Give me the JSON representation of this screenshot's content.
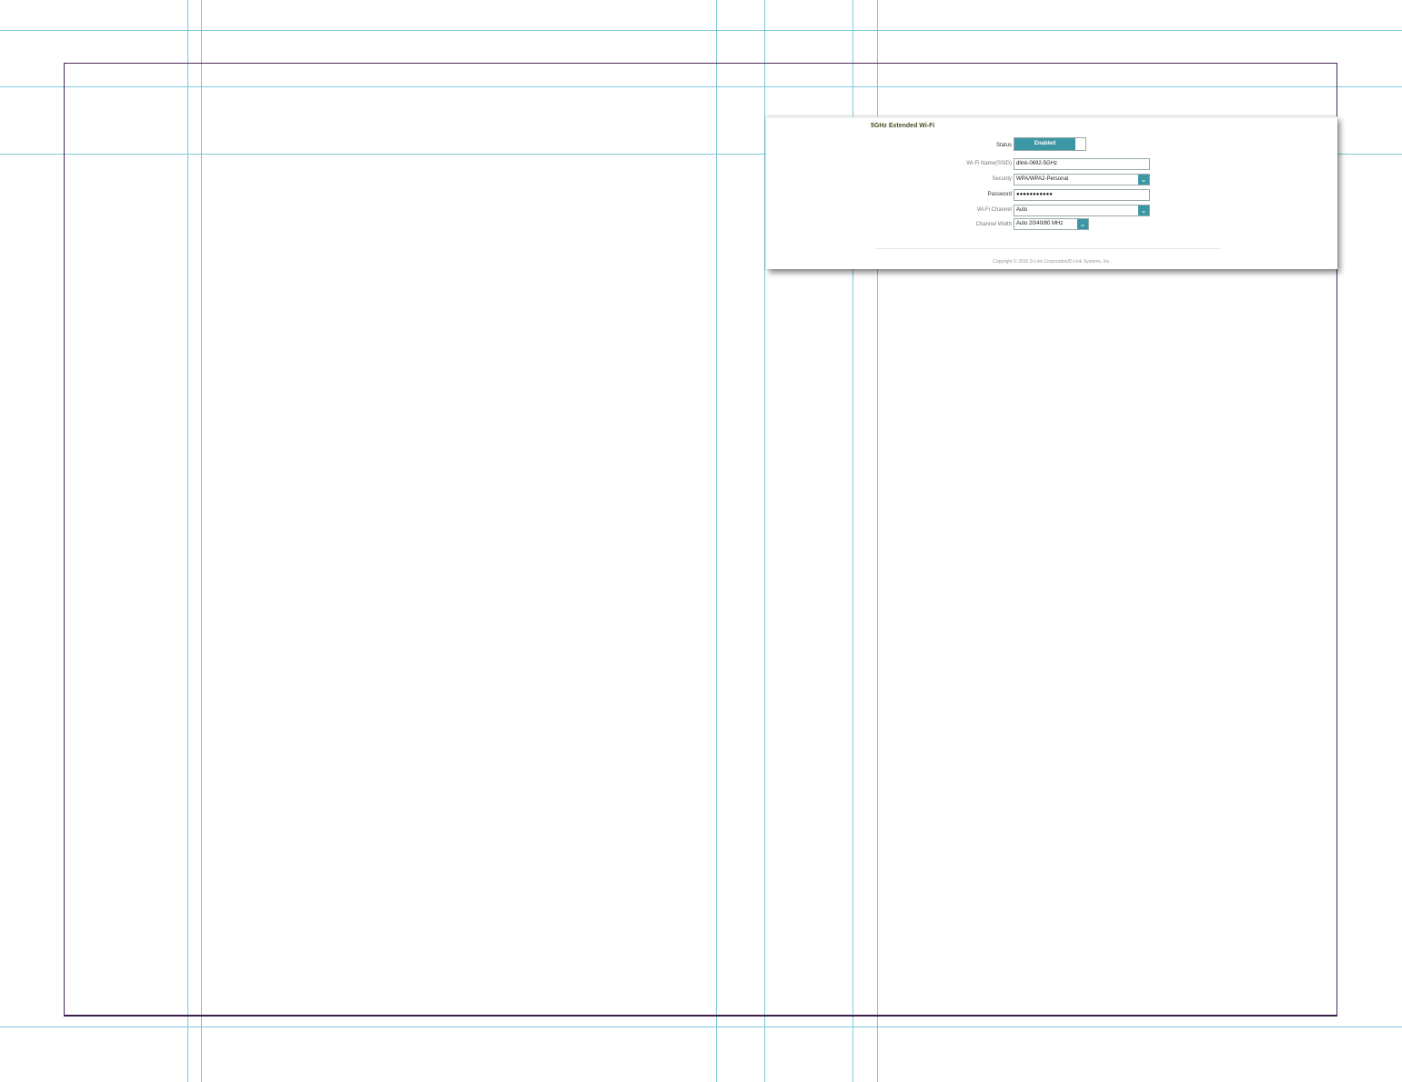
{
  "section": {
    "title": "5GHz Extended Wi-Fi"
  },
  "rows": {
    "status": {
      "label": "Status",
      "value": "Enabled"
    },
    "ssid": {
      "label": "Wi-Fi Name(SSID)",
      "value": "dlink-0692-5GHz"
    },
    "security": {
      "label": "Security",
      "value": "WPA/WPA2-Personal"
    },
    "password": {
      "label": "Password",
      "value": "●●●●●●●●●●●"
    },
    "channel": {
      "label": "Wi-Fi Channel",
      "value": "Auto"
    },
    "width": {
      "label": "Channel Width",
      "value": "Auto 20/40/80 MHz"
    }
  },
  "footer": {
    "copyright": "Copyright © 2015 D-Link Corporation/D-Link Systems, Inc."
  },
  "colors": {
    "accent": "#3b97a3",
    "guide": "#7fc9dc",
    "frame": "#4a2a5a"
  },
  "icons": {
    "dropdown": "chevron-down-icon"
  }
}
